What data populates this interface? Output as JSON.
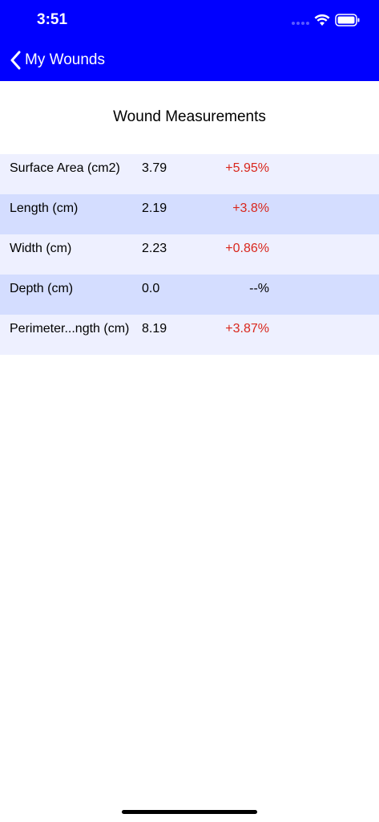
{
  "status_bar": {
    "time": "3:51",
    "wifi_icon": "wifi-icon",
    "battery_icon": "battery-icon"
  },
  "nav": {
    "back_label": "My Wounds",
    "back_icon": "chevron-left-icon",
    "background_color": "#0000ff"
  },
  "page": {
    "title": "Wound Measurements"
  },
  "measurements": [
    {
      "label": "Surface Area (cm2)",
      "value": "3.79",
      "change": "+5.95%",
      "change_color": "#d9261c"
    },
    {
      "label": "Length (cm)",
      "value": "2.19",
      "change": "+3.8%",
      "change_color": "#d9261c"
    },
    {
      "label": "Width (cm)",
      "value": "2.23",
      "change": "+0.86%",
      "change_color": "#d9261c"
    },
    {
      "label": "Depth (cm)",
      "value": "0.0",
      "change": "--%",
      "change_color": "#000000"
    },
    {
      "label": "Perimeter...ngth (cm)",
      "value": "8.19",
      "change": "+3.87%",
      "change_color": "#d9261c"
    }
  ],
  "colors": {
    "row_light": "#eef0ff",
    "row_dark": "#d4ddff"
  }
}
